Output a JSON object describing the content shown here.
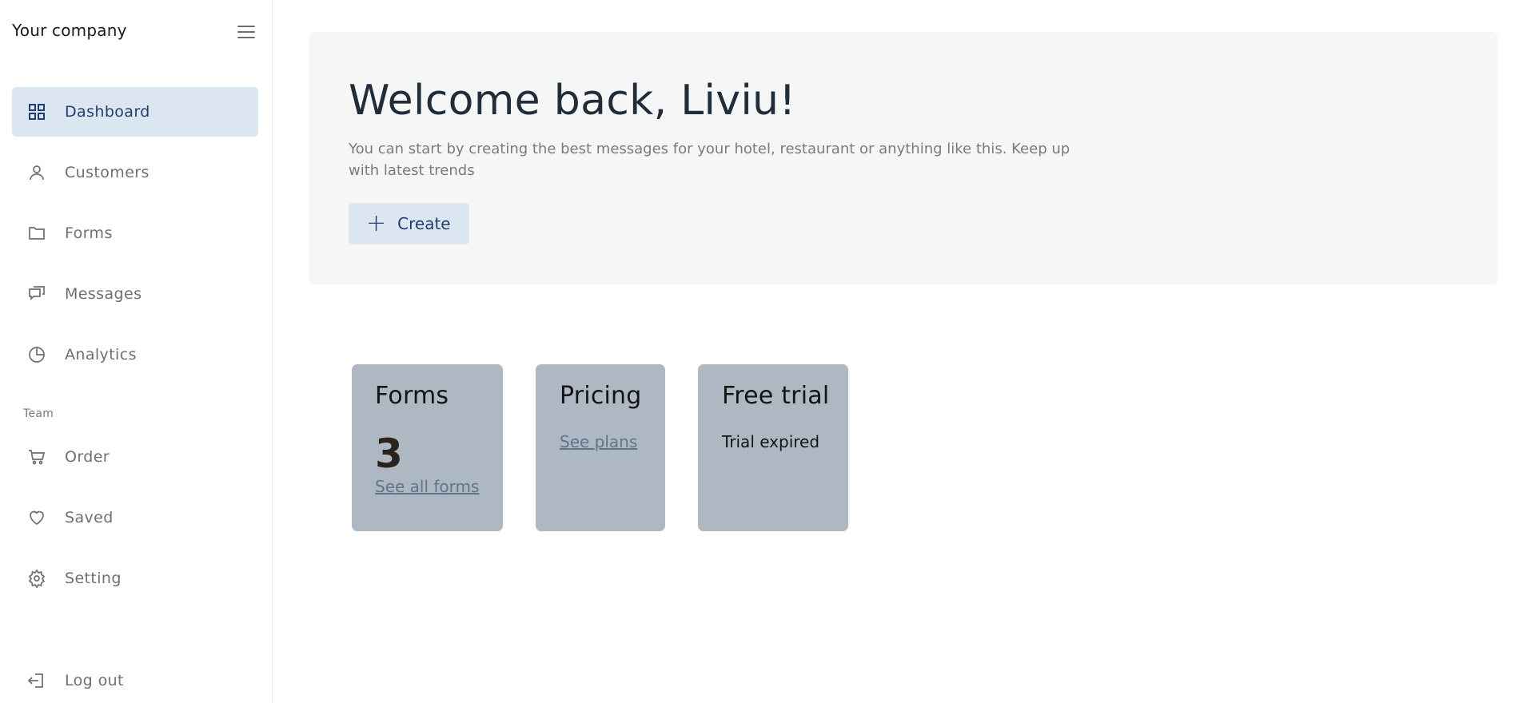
{
  "sidebar": {
    "brand": "Your company",
    "items": [
      {
        "label": "Dashboard",
        "icon": "dashboard-icon",
        "active": true
      },
      {
        "label": "Customers",
        "icon": "user-icon"
      },
      {
        "label": "Forms",
        "icon": "folder-icon"
      },
      {
        "label": "Messages",
        "icon": "chat-icon"
      },
      {
        "label": "Analytics",
        "icon": "pie-chart-icon"
      }
    ],
    "team_label": "Team",
    "team_items": [
      {
        "label": "Order",
        "icon": "cart-icon"
      },
      {
        "label": "Saved",
        "icon": "heart-icon"
      },
      {
        "label": "Setting",
        "icon": "gear-icon"
      }
    ],
    "logout_label": "Log out"
  },
  "hero": {
    "title": "Welcome back, Liviu!",
    "description": "You can start by creating the best messages for your hotel, restaurant or anything like this. Keep up with latest trends",
    "create_label": "Create"
  },
  "cards": {
    "forms": {
      "title": "Forms",
      "value": "3",
      "link": "See all forms"
    },
    "pricing": {
      "title": "Pricing",
      "link": "See plans"
    },
    "trial": {
      "title": "Free trial",
      "text": "Trial expired"
    }
  },
  "colors": {
    "accent_bg": "#dce6f0",
    "accent_text": "#1f3f73",
    "card_bg": "#adb8c3",
    "hero_bg": "#f6f6f6"
  }
}
